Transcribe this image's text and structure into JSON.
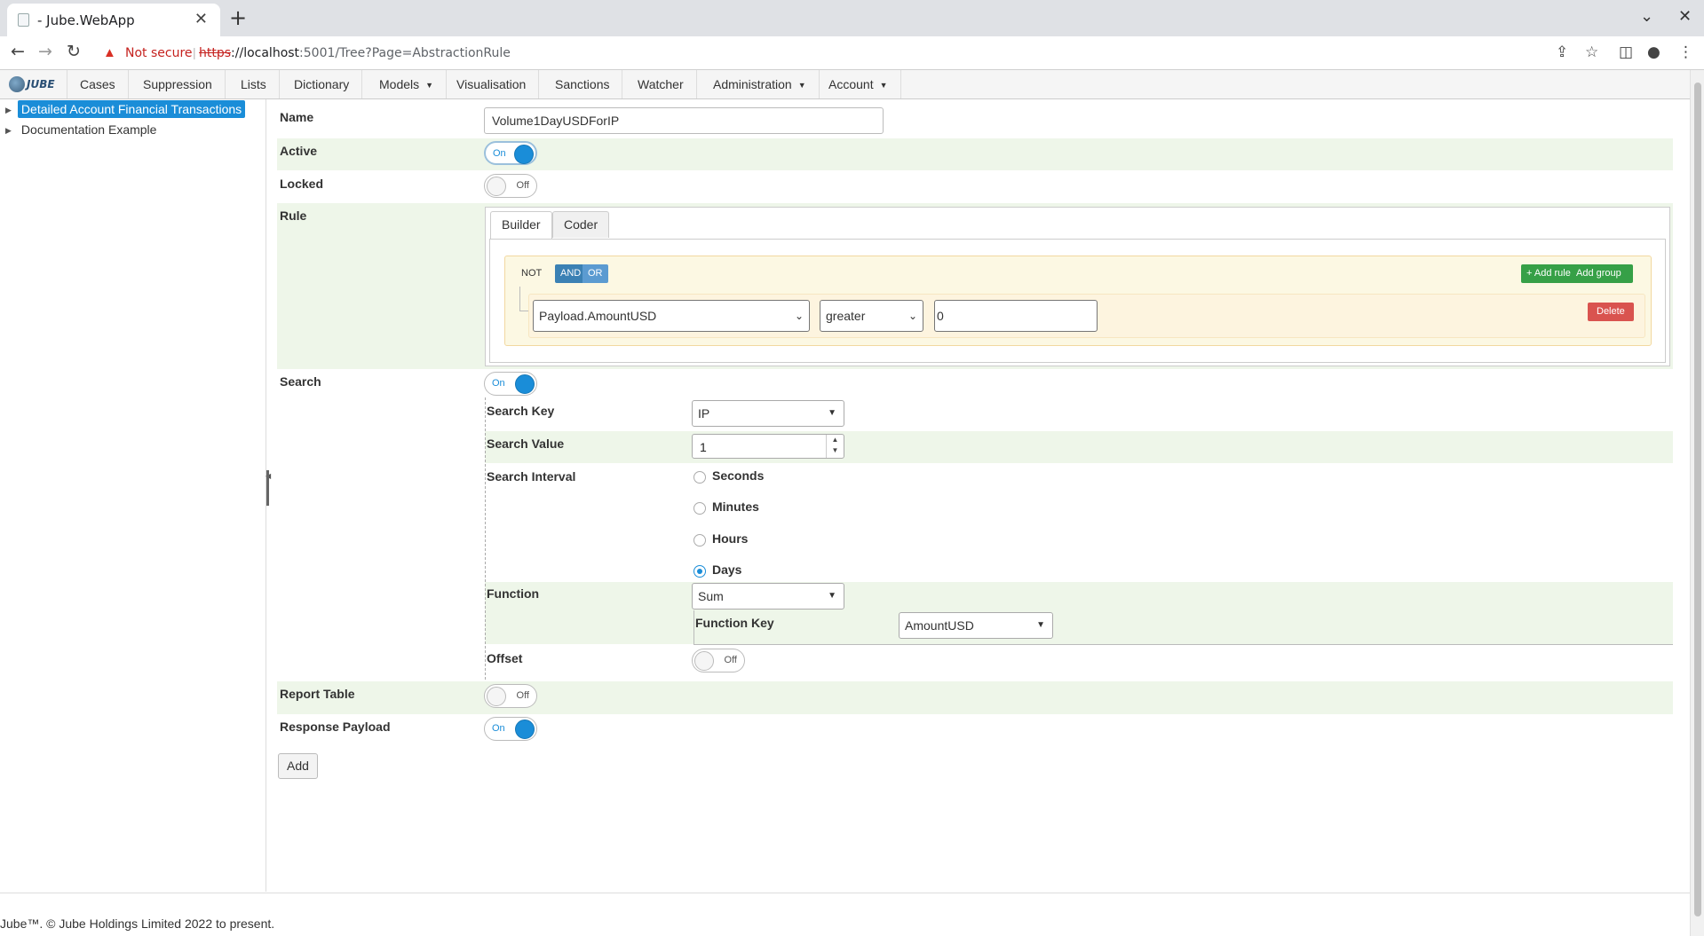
{
  "browser": {
    "tab_title": "- Jube.WebApp",
    "not_secure": "Not secure",
    "url_scheme": "https",
    "url_host": "://localhost",
    "url_rest": ":5001/Tree?Page=AbstractionRule"
  },
  "nav": {
    "logo_text": "JUBE",
    "items": [
      {
        "label": "Cases"
      },
      {
        "label": "Suppression"
      },
      {
        "label": "Lists"
      },
      {
        "label": "Dictionary"
      },
      {
        "label": "Models",
        "dropdown": true
      },
      {
        "label": "Visualisation"
      },
      {
        "label": "Sanctions"
      },
      {
        "label": "Watcher"
      },
      {
        "label": "Administration",
        "dropdown": true
      },
      {
        "label": "Account",
        "dropdown": true
      }
    ]
  },
  "tree": {
    "items": [
      {
        "label": "Detailed Account Financial Transactions",
        "selected": true
      },
      {
        "label": "Documentation Example",
        "selected": false
      }
    ]
  },
  "form": {
    "name_label": "Name",
    "name_value": "Volume1DayUSDForIP",
    "active_label": "Active",
    "active_state": "On",
    "locked_label": "Locked",
    "locked_state": "Off",
    "rule_label": "Rule",
    "rule": {
      "tabs": [
        "Builder",
        "Coder"
      ],
      "not": "NOT",
      "and": "AND",
      "or": "OR",
      "add_rule": "+ Add rule",
      "add_group": "Add group",
      "field": "Payload.AmountUSD",
      "operator": "greater",
      "value": "0",
      "delete": "Delete"
    },
    "search_label": "Search",
    "search_state": "On",
    "search_key_label": "Search Key",
    "search_key_value": "IP",
    "search_value_label": "Search Value",
    "search_value": "1",
    "search_interval_label": "Search Interval",
    "intervals": [
      {
        "label": "Seconds",
        "checked": false
      },
      {
        "label": "Minutes",
        "checked": false
      },
      {
        "label": "Hours",
        "checked": false
      },
      {
        "label": "Days",
        "checked": true
      }
    ],
    "function_label": "Function",
    "function_value": "Sum",
    "function_key_label": "Function Key",
    "function_key_value": "AmountUSD",
    "offset_label": "Offset",
    "offset_state": "Off",
    "report_table_label": "Report Table",
    "report_table_state": "Off",
    "response_payload_label": "Response Payload",
    "response_payload_state": "On",
    "add_button": "Add"
  },
  "footer": {
    "text": "Jube™. © Jube Holdings Limited 2022 to present."
  },
  "colors": {
    "accent": "#1a8dd8",
    "green": "#36a047",
    "danger": "#d9534f",
    "row_alt": "#eef6e9"
  }
}
